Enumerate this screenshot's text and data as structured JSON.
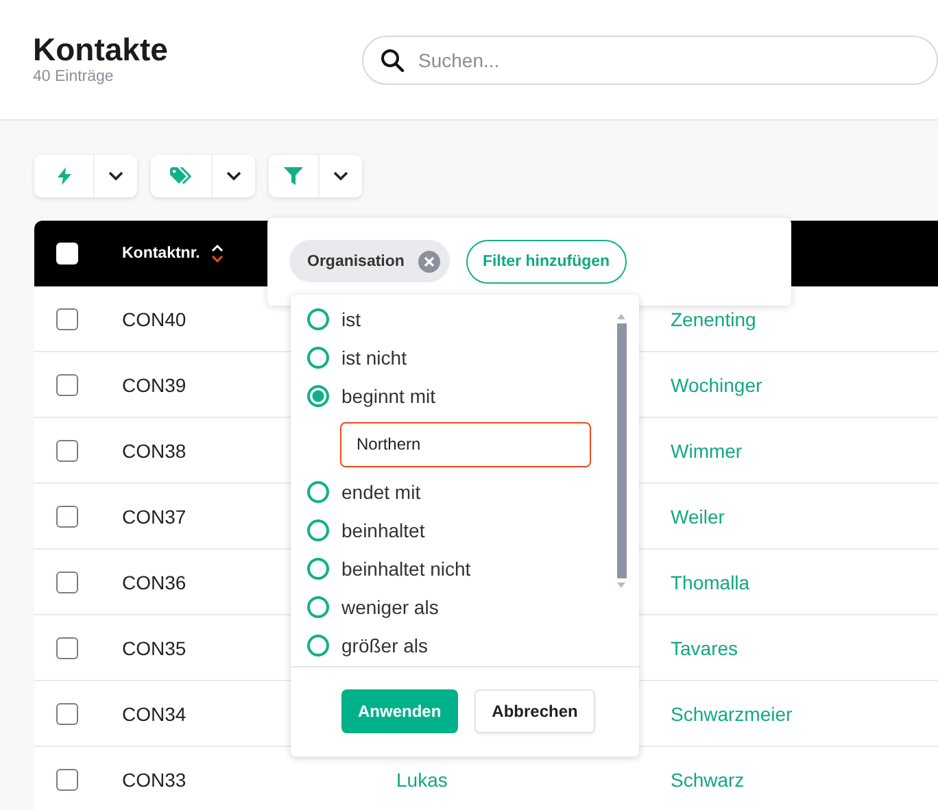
{
  "header": {
    "title": "Kontakte",
    "subtitle": "40 Einträge"
  },
  "search": {
    "placeholder": "Suchen..."
  },
  "table": {
    "select_all": {
      "checked": false
    },
    "columns": [
      {
        "label": "Kontaktnr.",
        "sorted_descending": true
      }
    ],
    "rows": [
      {
        "checked": false,
        "number": "CON40",
        "last_name": "Zenenting"
      },
      {
        "checked": false,
        "number": "CON39",
        "last_name": "Wochinger"
      },
      {
        "checked": false,
        "number": "CON38",
        "last_name": "Wimmer"
      },
      {
        "checked": false,
        "number": "CON37",
        "last_name": "Weiler"
      },
      {
        "checked": false,
        "number": "CON36",
        "last_name": "Thomalla"
      },
      {
        "checked": false,
        "number": "CON35",
        "last_name": "Tavares"
      },
      {
        "checked": false,
        "number": "CON34",
        "last_name": "Schwarzmeier"
      },
      {
        "checked": false,
        "number": "CON33",
        "first_name": "Lukas",
        "last_name": "Schwarz"
      }
    ]
  },
  "filter_popup": {
    "chips": [
      {
        "label": "Organisation"
      }
    ],
    "add_button": "Filter hinzufügen",
    "options": [
      {
        "label": "ist",
        "selected": false
      },
      {
        "label": "ist nicht",
        "selected": false
      },
      {
        "label": "beginnt mit",
        "selected": true
      },
      {
        "label": "endet mit",
        "selected": false
      },
      {
        "label": "beinhaltet",
        "selected": false
      },
      {
        "label": "beinhaltet nicht",
        "selected": false
      },
      {
        "label": "weniger als",
        "selected": false
      },
      {
        "label": "größer als",
        "selected": false
      }
    ],
    "value": "Northern",
    "buttons": [
      {
        "label": "Anwenden",
        "kind": "primary"
      },
      {
        "label": "Abbrechen",
        "kind": "secondary"
      }
    ]
  }
}
